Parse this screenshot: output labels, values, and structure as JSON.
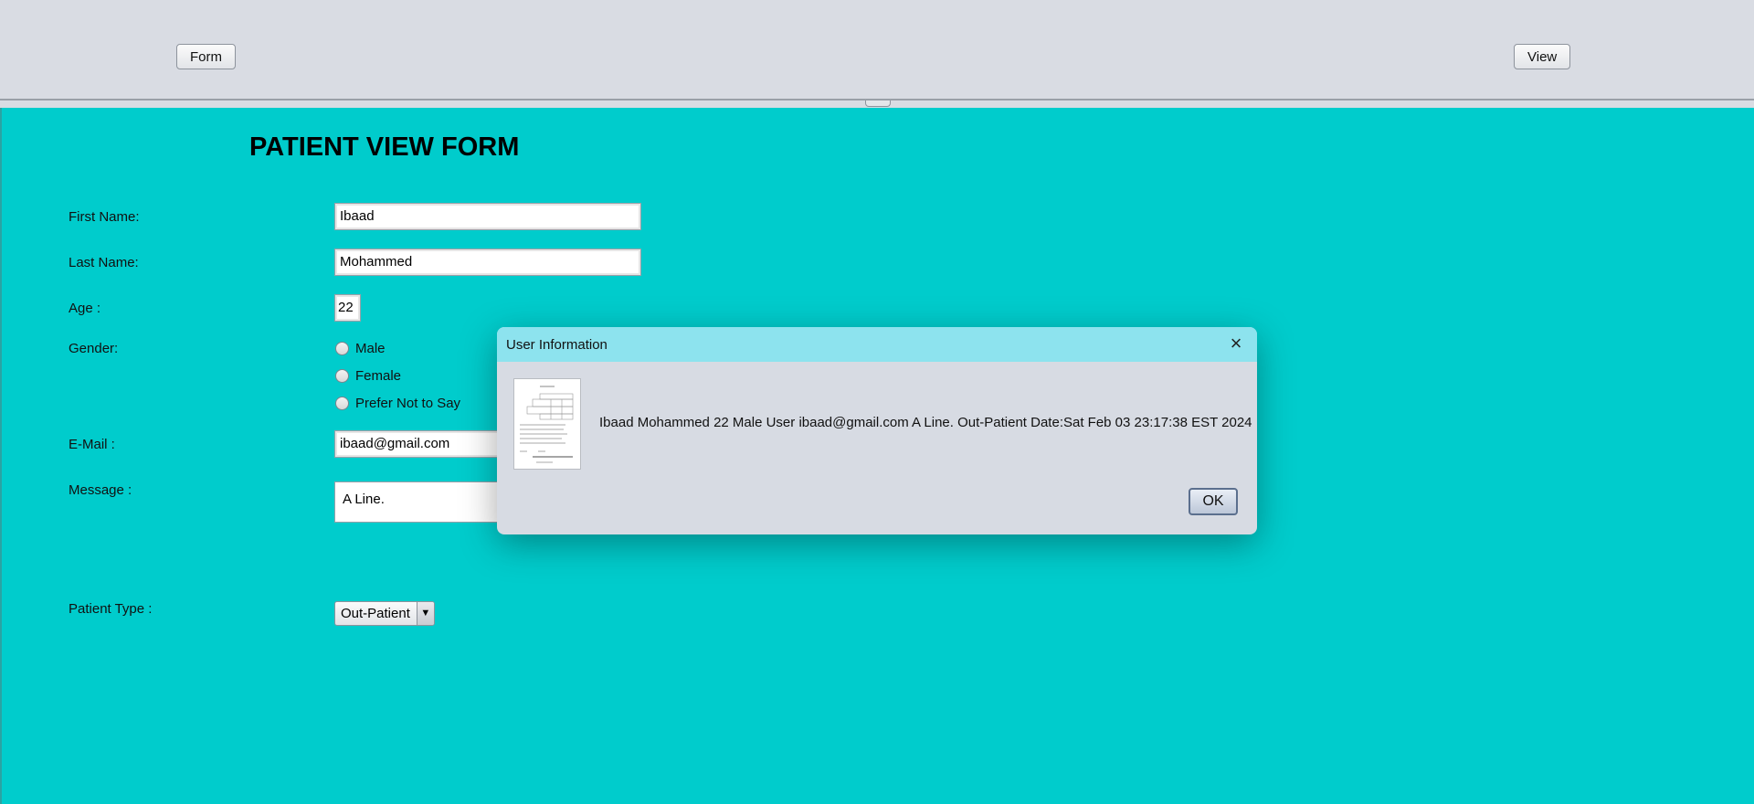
{
  "toolbar": {
    "form_label": "Form",
    "view_label": "View"
  },
  "form": {
    "title": "PATIENT VIEW FORM",
    "first_name_label": "First Name:",
    "first_name_value": "Ibaad",
    "last_name_label": "Last Name:",
    "last_name_value": "Mohammed",
    "age_label": "Age :",
    "age_value": "22",
    "gender_label": "Gender:",
    "gender_options": [
      "Male",
      "Female",
      "Prefer Not to Say"
    ],
    "email_label": "E-Mail :",
    "email_value": "ibaad@gmail.com",
    "message_label": "Message :",
    "message_value": "A Line.",
    "patient_type_label": "Patient Type :",
    "patient_type_value": "Out-Patient"
  },
  "dialog": {
    "title": "User Information",
    "message": "Ibaad Mohammed 22 Male User ibaad@gmail.com A Line. Out-Patient  Date:Sat Feb 03 23:17:38 EST 2024",
    "ok_label": "OK"
  },
  "colors": {
    "panel_background": "#00cccc",
    "dialog_titlebar": "#8de3ee",
    "toolbar_background": "#d9dce3"
  }
}
